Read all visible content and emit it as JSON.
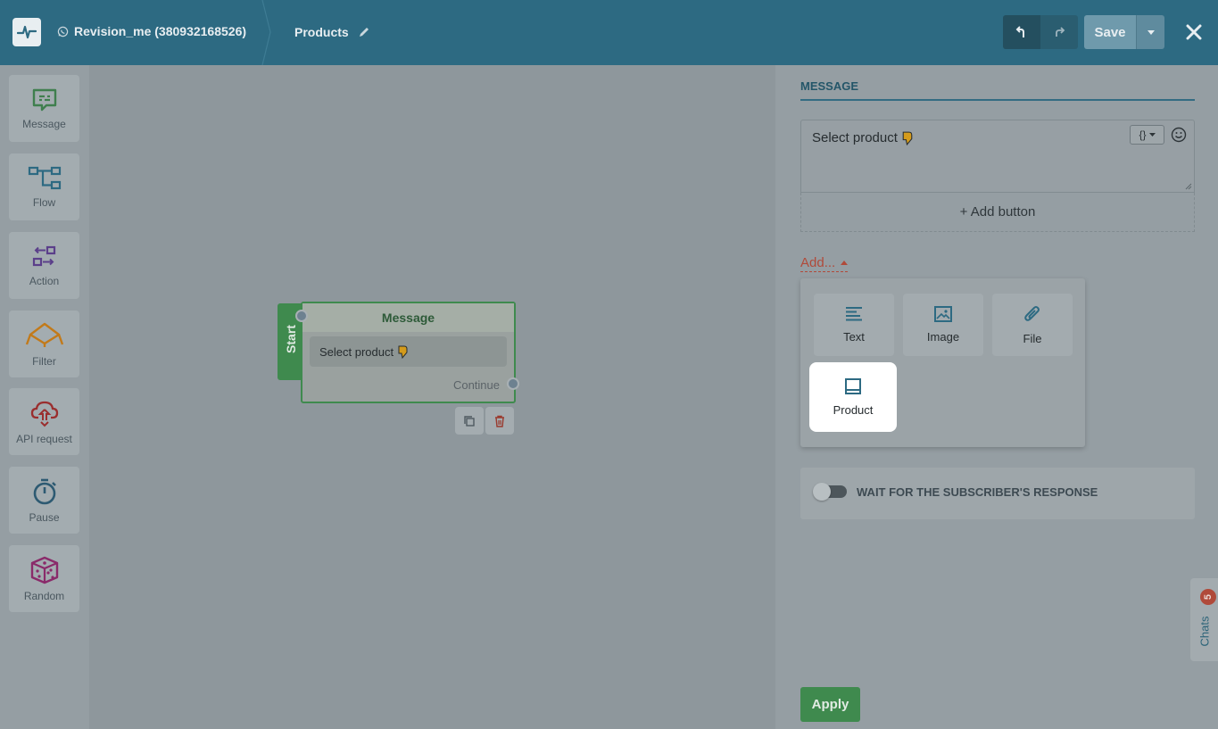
{
  "header": {
    "bot_name": "Revision_me (380932168526)",
    "flow_name": "Products",
    "save_label": "Save",
    "icons": [
      "pulse-logo-icon",
      "whatsapp-icon",
      "pencil-icon",
      "undo-icon",
      "redo-icon",
      "caret-down-icon",
      "close-icon"
    ]
  },
  "palette": {
    "items": [
      {
        "label": "Message",
        "icon": "message-icon",
        "color": "#3f7f4e"
      },
      {
        "label": "Flow",
        "icon": "flow-icon",
        "color": "#2d6a82"
      },
      {
        "label": "Action",
        "icon": "action-icon",
        "color": "#5b3f8a"
      },
      {
        "label": "Filter",
        "icon": "filter-icon",
        "color": "#c27a1a"
      },
      {
        "label": "API request",
        "icon": "cloud-api-icon",
        "color": "#9a2e2e"
      },
      {
        "label": "Pause",
        "icon": "stopwatch-icon",
        "color": "#2d5a72"
      },
      {
        "label": "Random",
        "icon": "dice-icon",
        "color": "#8a2a6a"
      }
    ]
  },
  "canvas": {
    "start_label": "Start",
    "node": {
      "title": "Message",
      "message": "Select product",
      "continue_label": "Continue"
    }
  },
  "panel": {
    "tab_label": "MESSAGE",
    "message_text": "Select product",
    "variables_label": "{}",
    "add_button_label": "+ Add button",
    "add_label": "Add...",
    "add_options": [
      {
        "label": "Text",
        "icon": "text-lines-icon"
      },
      {
        "label": "Image",
        "icon": "image-icon"
      },
      {
        "label": "File",
        "icon": "paperclip-icon"
      },
      {
        "label": "Product",
        "icon": "product-icon"
      }
    ],
    "wait_label": "WAIT FOR THE SUBSCRIBER'S RESPONSE",
    "wait_enabled": false,
    "apply_label": "Apply"
  },
  "chats": {
    "label": "Chats",
    "count": "5"
  },
  "colors": {
    "header_bg": "#2d6a82",
    "start_green": "#3f8a4e",
    "link_red": "#b04a3a"
  }
}
